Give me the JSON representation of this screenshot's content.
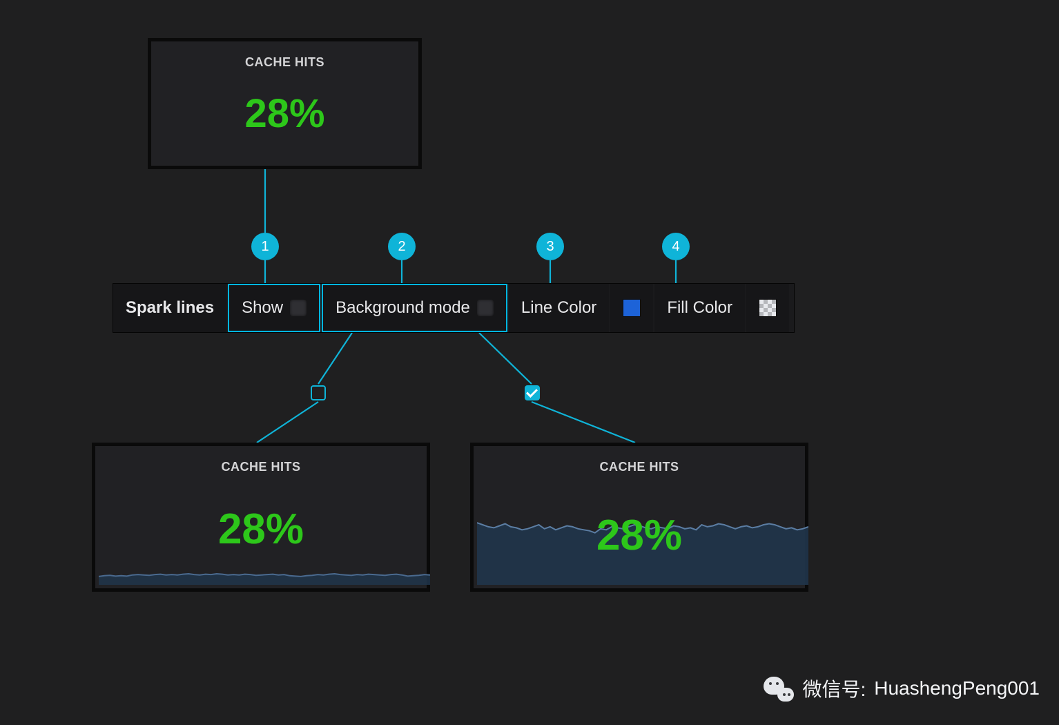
{
  "top_panel": {
    "title": "CACHE HITS",
    "value": "28%"
  },
  "toolbar": {
    "section_label": "Spark lines",
    "show_label": "Show",
    "background_mode_label": "Background mode",
    "line_color_label": "Line Color",
    "fill_color_label": "Fill Color",
    "line_color": "#1d63d8"
  },
  "badges": {
    "b1": "1",
    "b2": "2",
    "b3": "3",
    "b4": "4"
  },
  "left_panel": {
    "title": "CACHE HITS",
    "value": "28%"
  },
  "right_panel": {
    "title": "CACHE HITS",
    "value": "28%"
  },
  "watermark": {
    "label": "微信号:",
    "value": "HuashengPeng001"
  },
  "chart_data": [
    {
      "type": "line",
      "title": "CACHE HITS sparkline (unchecked background mode)",
      "ylim": [
        0,
        100
      ],
      "values": [
        22,
        24,
        25,
        23,
        24,
        23,
        26,
        27,
        26,
        25,
        27,
        28,
        26,
        27,
        26,
        28,
        29,
        27,
        26,
        28,
        27,
        29,
        28,
        26,
        27,
        26,
        28,
        27,
        25,
        26,
        27,
        28,
        26,
        27,
        24,
        23,
        22,
        24,
        25,
        27,
        26,
        28,
        29,
        27,
        26,
        25,
        27,
        26,
        28,
        27,
        26,
        25,
        27,
        28,
        26,
        23,
        24,
        25,
        27,
        26
      ]
    },
    {
      "type": "area",
      "title": "CACHE HITS sparkline (checked background mode)",
      "ylim": [
        0,
        100
      ],
      "values": [
        62,
        60,
        58,
        57,
        59,
        61,
        58,
        57,
        55,
        56,
        58,
        60,
        56,
        58,
        55,
        57,
        59,
        58,
        56,
        55,
        54,
        52,
        56,
        55,
        58,
        57,
        56,
        58,
        60,
        59,
        57,
        56,
        58,
        57,
        56,
        59,
        58,
        56,
        57,
        55,
        60,
        58,
        59,
        61,
        60,
        58,
        56,
        58,
        59,
        57,
        58,
        60,
        61,
        60,
        58,
        56,
        57,
        55,
        56,
        58
      ]
    }
  ]
}
